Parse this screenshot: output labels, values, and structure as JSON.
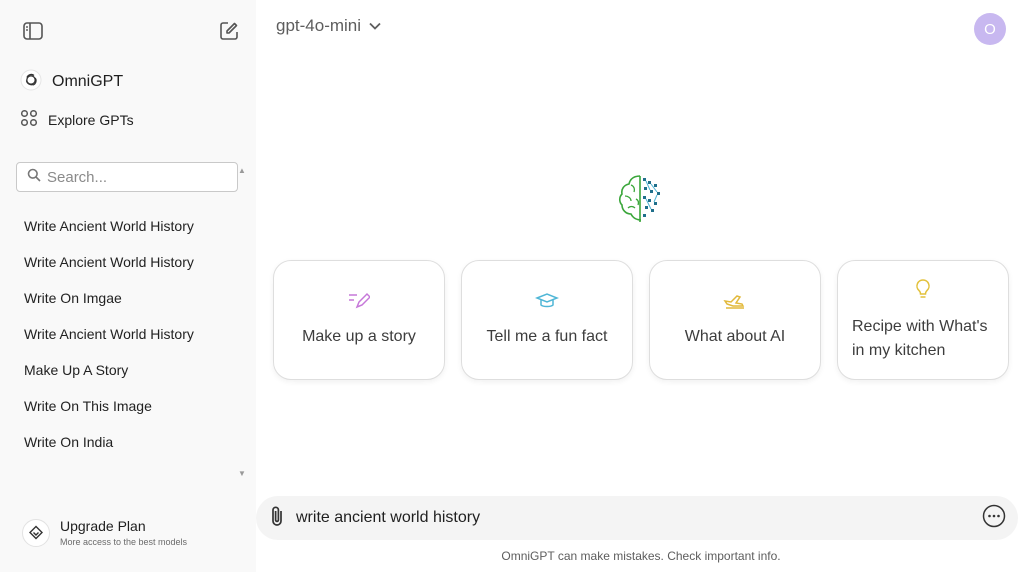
{
  "sidebar": {
    "brand_label": "OmniGPT",
    "explore_label": "Explore GPTs",
    "search_placeholder": "Search...",
    "history": [
      {
        "label": "Write Ancient World History"
      },
      {
        "label": "Write Ancient World History"
      },
      {
        "label": "Write On Imgae"
      },
      {
        "label": "Write Ancient World History"
      },
      {
        "label": "Make Up A Story"
      },
      {
        "label": "Write On This Image"
      },
      {
        "label": "Write On India"
      }
    ],
    "upgrade_title": "Upgrade Plan",
    "upgrade_subtitle": "More access to the best models"
  },
  "header": {
    "model_name": "gpt-4o-mini",
    "avatar_initial": "O"
  },
  "suggestions": [
    {
      "label": "Make up a story",
      "icon": "pencil-lines-icon",
      "color": "#c678d9"
    },
    {
      "label": "Tell me a fun fact",
      "icon": "graduation-cap-icon",
      "color": "#4fb6d6"
    },
    {
      "label": "What about AI",
      "icon": "plane-icon",
      "color": "#e2b93b"
    },
    {
      "label": "Recipe with What's in my kitchen",
      "icon": "lightbulb-icon",
      "color": "#e2c13b"
    }
  ],
  "composer": {
    "value": "write ancient world history"
  },
  "footer_note": "OmniGPT can make mistakes. Check important info.",
  "colors": {
    "sidebar_bg": "#f9f9f9",
    "avatar_bg": "#c8b8f0",
    "logo_green": "#3aa63a",
    "logo_teal": "#1f6f8b"
  }
}
